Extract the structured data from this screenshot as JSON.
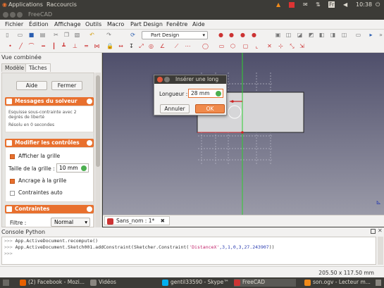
{
  "top_panel": {
    "apps": "Applications",
    "shortcuts": "Raccourcis",
    "time": "10:38",
    "keyboard": "Fr"
  },
  "window": {
    "title": "FreeCAD"
  },
  "menu": [
    "Fichier",
    "Édition",
    "Affichage",
    "Outils",
    "Macro",
    "Part Design",
    "Fenêtre",
    "Aide"
  ],
  "toolbar": {
    "workbench": "Part Design"
  },
  "left_panel": {
    "title": "Vue combinée",
    "tabs": [
      "Modèle",
      "Tâches"
    ],
    "help_button": "Aide",
    "close_button": "Fermer",
    "solver": {
      "header": "Messages du solveur",
      "message": "Esquisse sous-contrainte avec 2 degrés de liberté",
      "time": "Résolu en 0 secondes"
    },
    "controls": {
      "header": "Modifier les contrôles",
      "show_grid": "Afficher la grille",
      "grid_size_label": "Taille de la grille :",
      "grid_size": "10 mm",
      "snap_grid": "Ancrage à la grille",
      "auto_constraints": "Contraintes auto"
    },
    "constraints": {
      "header": "Contraintes",
      "filter_label": "Filtre :",
      "filter_value": "Normal"
    }
  },
  "dialog": {
    "title": "Insérer une long",
    "length_label": "Longueur :",
    "length_value": "28 mm",
    "cancel": "Annuler",
    "ok": "OK"
  },
  "doc_tab": "Sans_nom : 1*",
  "python_console": {
    "title": "Console Python",
    "prompt": ">>>",
    "line1": "App.ActiveDocument.recompute()",
    "line2_pre": "App.ActiveDocument.Sketch001.addConstraint(Sketcher.Constraint(",
    "line2_str": "'DistanceX'",
    "line2_nums": ",3,1,0,3,27.243907",
    "line2_post": "))"
  },
  "status": "205.50 x 117.50 mm",
  "taskbar": [
    "(2) Facebook - Mozi...",
    "Vidéos",
    "gentil33590 - Skype™",
    "FreeCAD",
    "son.ogv - Lecteur m..."
  ],
  "colors": {
    "accent": "#e8702e",
    "viewport": "#5a5a72",
    "sketch_face": "#d6d6d8",
    "constraint_red": "#cc2222",
    "axis_green": "#2fcf2f"
  }
}
